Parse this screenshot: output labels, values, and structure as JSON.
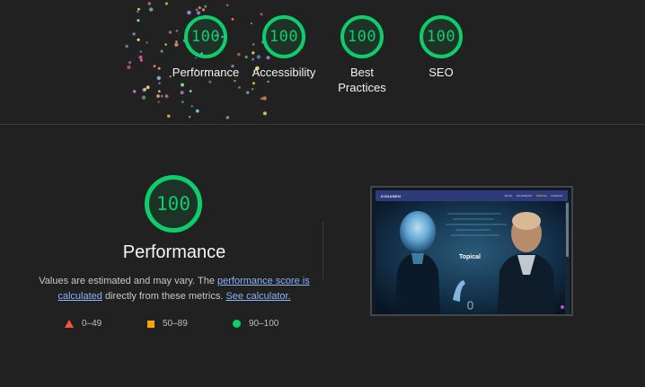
{
  "colors": {
    "pass": "#0cce6b",
    "average": "#ffa400",
    "fail": "#ff4e42",
    "link": "#8ab4f8",
    "background": "#212121"
  },
  "gauges": [
    {
      "score": "100",
      "label": "Performance"
    },
    {
      "score": "100",
      "label": "Accessibility"
    },
    {
      "score": "100",
      "label": "Best Practices"
    },
    {
      "score": "100",
      "label": "SEO"
    }
  ],
  "performance": {
    "score": "100",
    "title": "Performance",
    "desc_part1": "Values are estimated and may vary. The ",
    "link1": "performance score is calculated",
    "desc_part2": " directly from these metrics. ",
    "link2": "See calculator."
  },
  "legend": [
    {
      "icon": "triangle-icon",
      "range": "0–49"
    },
    {
      "icon": "square-icon",
      "range": "50–89"
    },
    {
      "icon": "circle-icon",
      "range": "90–100"
    }
  ],
  "thumbnail": {
    "brand": "KODAMEN",
    "nav": [
      "BLOG",
      "TELEGRAPH",
      "TOPICAL",
      "CAMPUS"
    ],
    "active_nav": "TOPICAL",
    "hero_text": "Topical"
  }
}
